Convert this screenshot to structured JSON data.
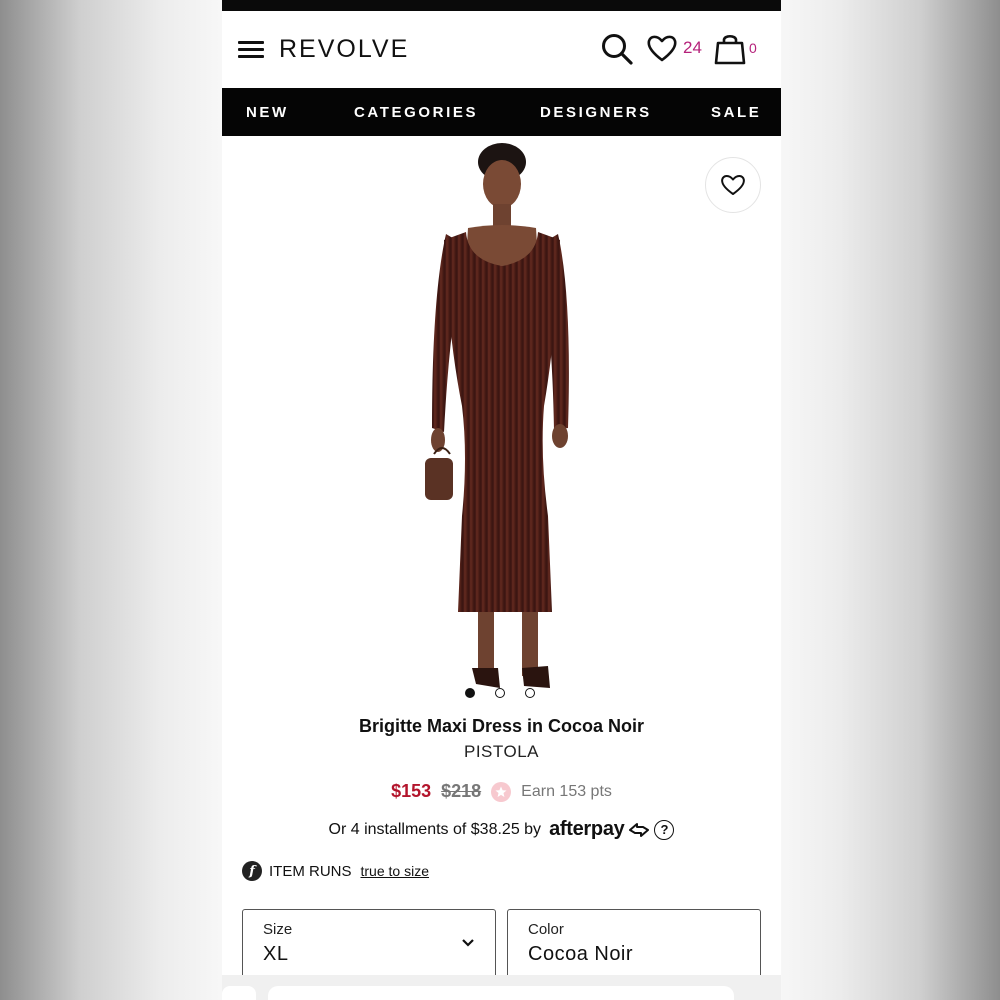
{
  "header": {
    "logo": "REVOLVE",
    "wishlist_count": "24",
    "bag_count": "0"
  },
  "nav": {
    "items": [
      "NEW",
      "CATEGORIES",
      "DESIGNERS",
      "SALE"
    ]
  },
  "carousel": {
    "total_images": 3,
    "active_index": 0
  },
  "product": {
    "title": "Brigitte Maxi Dress in Cocoa Noir",
    "brand": "PISTOLA",
    "sale_price": "$153",
    "original_price": "$218",
    "points": "Earn 153 pts",
    "installments_text": "Or 4 installments of $38.25 by",
    "afterpay_logo": "afterpay",
    "fit_label": "ITEM RUNS",
    "fit_link": "true to size"
  },
  "size_select": {
    "label": "Size",
    "value": "XL"
  },
  "color_select": {
    "label": "Color",
    "value": "Cocoa Noir"
  },
  "colors": {
    "accent": "#b5217a",
    "sale": "#b3152c",
    "dress": "#5a2620"
  }
}
